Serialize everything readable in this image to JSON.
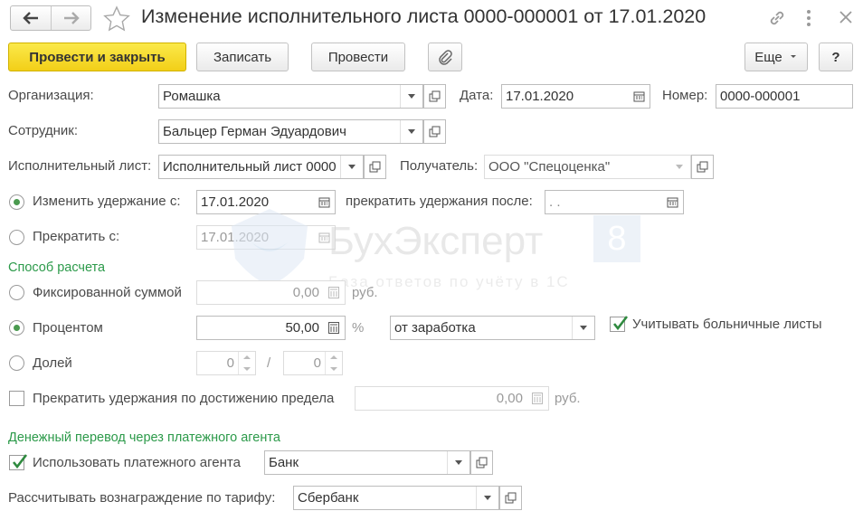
{
  "window": {
    "title": "Изменение исполнительного листа 0000-000001 от 17.01.2020"
  },
  "toolbar": {
    "post_close": "Провести и закрыть",
    "save": "Записать",
    "post": "Провести",
    "more": "Еще",
    "help": "?"
  },
  "header": {
    "org_label": "Организация:",
    "org_value": "Ромашка",
    "date_label": "Дата:",
    "date_value": "17.01.2020",
    "number_label": "Номер:",
    "number_value": "0000-000001",
    "employee_label": "Сотрудник:",
    "employee_value": "Бальцер Герман Эдуардович",
    "writ_label": "Исполнительный лист:",
    "writ_value": "Исполнительный лист 0000",
    "recipient_label": "Получатель:",
    "recipient_value": "ООО \"Спецоценка\""
  },
  "change": {
    "change_from_label": "Изменить удержание с:",
    "change_from_value": "17.01.2020",
    "stop_after_label": "прекратить удержания после:",
    "stop_after_value": " .  .",
    "stop_from_label": "Прекратить с:",
    "stop_from_value": "17.01.2020"
  },
  "calc": {
    "section_title": "Способ расчета",
    "fixed_label": "Фиксированной суммой",
    "fixed_value": "0,00",
    "fixed_unit": "руб.",
    "percent_label": "Процентом",
    "percent_value": "50,00",
    "percent_unit": "%",
    "base_value": "от заработка",
    "sick_label": "Учитывать больничные листы",
    "share_label": "Долей",
    "share_num": "0",
    "share_sep": "/",
    "share_den": "0",
    "limit_label": "Прекратить удержания по достижению предела",
    "limit_value": "0,00",
    "limit_unit": "руб."
  },
  "transfer": {
    "section_title": "Денежный перевод через платежного агента",
    "use_agent_label": "Использовать платежного агента",
    "agent_value": "Банк",
    "tariff_label": "Рассчитывать вознаграждение по тарифу:",
    "tariff_value": "Сбербанк"
  },
  "watermark": {
    "brand": "БухЭксперт",
    "digit": "8",
    "tagline": "База ответов по учёту в 1С"
  },
  "colors": {
    "primary_button": "#f5d523",
    "accent_green": "#2c9a4a",
    "radio_dot": "#4a9a4f"
  }
}
